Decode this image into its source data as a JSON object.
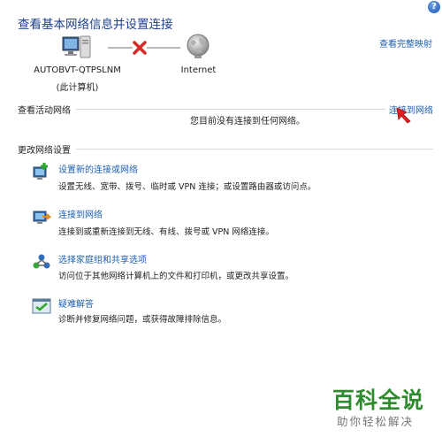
{
  "window": {
    "title": "查看基本网络信息并设置连接",
    "help_glyph": "?"
  },
  "header": {
    "view_full_map": "查看完整映射"
  },
  "network_map": {
    "computer_name": "AUTOBVT-QTPSLNM",
    "computer_sub": "(此计算机)",
    "internet_label": "Internet",
    "status_color": "#d62a2a"
  },
  "active_networks": {
    "section_title": "查看活动网络",
    "connect_link": "连接到网络",
    "no_network_text": "您目前没有连接到任何网络。"
  },
  "change_settings": {
    "section_title": "更改网络设置",
    "tasks": [
      {
        "icon": "new-connection-icon",
        "title": "设置新的连接或网络",
        "desc": "设置无线、宽带、拨号、临时或 VPN 连接；或设置路由器或访问点。"
      },
      {
        "icon": "connect-network-icon",
        "title": "连接到网络",
        "desc": "连接到或重新连接到无线、有线、拨号或 VPN 网络连接。"
      },
      {
        "icon": "homegroup-sharing-icon",
        "title": "选择家庭组和共享选项",
        "desc": "访问位于其他网络计算机上的文件和打印机，或更改共享设置。"
      },
      {
        "icon": "troubleshoot-icon",
        "title": "疑难解答",
        "desc": "诊断并修复网络问题，或获得故障排除信息。"
      }
    ]
  },
  "watermark": {
    "title": "百科全说",
    "subtitle": "助你轻松解决"
  },
  "colors": {
    "link": "#1e5fb4",
    "title": "#1e3f8f",
    "watermark": "#2e8b2e",
    "cursor": "#e02020"
  }
}
